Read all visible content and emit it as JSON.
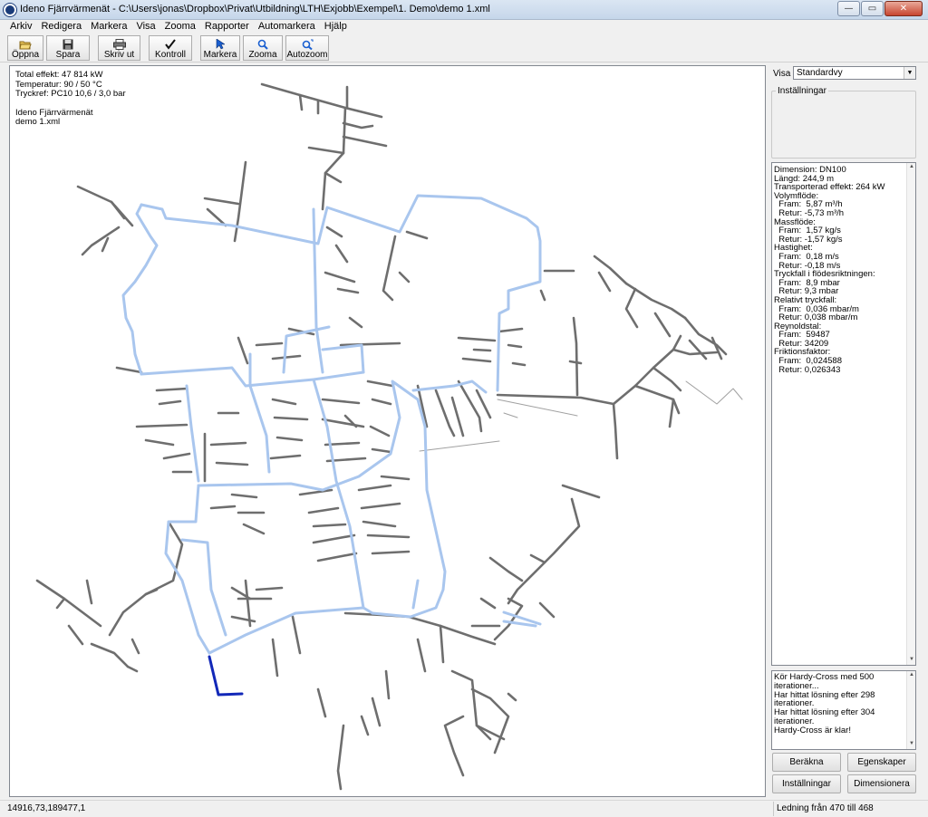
{
  "window": {
    "title": "Ideno Fjärrvärmenät - C:\\Users\\jonas\\Dropbox\\Privat\\Utbildning\\LTH\\Exjobb\\Exempel\\1. Demo\\demo 1.xml",
    "minimize": "—",
    "maximize": "▭",
    "close": "✕"
  },
  "menu": [
    {
      "label": "Arkiv"
    },
    {
      "label": "Redigera"
    },
    {
      "label": "Markera"
    },
    {
      "label": "Visa"
    },
    {
      "label": "Zooma"
    },
    {
      "label": "Rapporter"
    },
    {
      "label": "Automarkera"
    },
    {
      "label": "Hjälp"
    }
  ],
  "toolbar": {
    "open": "Öppna",
    "save": "Spara",
    "print": "Skriv ut",
    "check": "Kontroll",
    "select": "Markera",
    "zoom": "Zooma",
    "autozoom": "Autozoom"
  },
  "map": {
    "overlay": {
      "total": "Total effekt: 47 814 kW",
      "temp": "Temperatur: 90 / 50 °C",
      "pressure": "Tryckref: PC10 10,6 / 3,0 bar",
      "name": "Ideno Fjärrvärmenät",
      "file": "demo 1.xml"
    },
    "colors": {
      "pipe": "#6e6e6e",
      "main": "#a9c6ee",
      "selected": "#1228b8"
    }
  },
  "panel": {
    "visa_label": "Visa",
    "visa_value": "Standardvy",
    "settings_legend": "Inställningar",
    "info_lines": [
      "Dimension: DN100",
      "Längd: 244,9 m",
      "Transporterad effekt: 264 kW",
      "Volymflöde:",
      "  Fram:  5,87 m³/h",
      "  Retur: -5,73 m³/h",
      "Massflöde:",
      "  Fram:  1,57 kg/s",
      "  Retur: -1,57 kg/s",
      "Hastighet:",
      "  Fram:  0,18 m/s",
      "  Retur: -0,18 m/s",
      "Tryckfall i flödesriktningen:",
      "  Fram:  8,9 mbar",
      "  Retur: 9,3 mbar",
      "Relativt tryckfall:",
      "  Fram:  0,036 mbar/m",
      "  Retur: 0,038 mbar/m",
      "Reynoldstal:",
      "  Fram:  59487",
      "  Retur: 34209",
      "Friktionsfaktor:",
      "  Fram:  0,024588",
      "  Retur: 0,026343"
    ],
    "log_lines": [
      "Kör Hardy-Cross med 500 iterationer...",
      "Har hittat lösning efter 298 iterationer.",
      "Har hittat lösning efter 304 iterationer.",
      "Hardy-Cross är klar!"
    ],
    "buttons": {
      "calculate": "Beräkna",
      "properties": "Egenskaper",
      "settings": "Inställningar",
      "dimension": "Dimensionera"
    }
  },
  "status": {
    "coords": "14916,73,189477,1",
    "info": "Ledning från 470 till 468"
  }
}
